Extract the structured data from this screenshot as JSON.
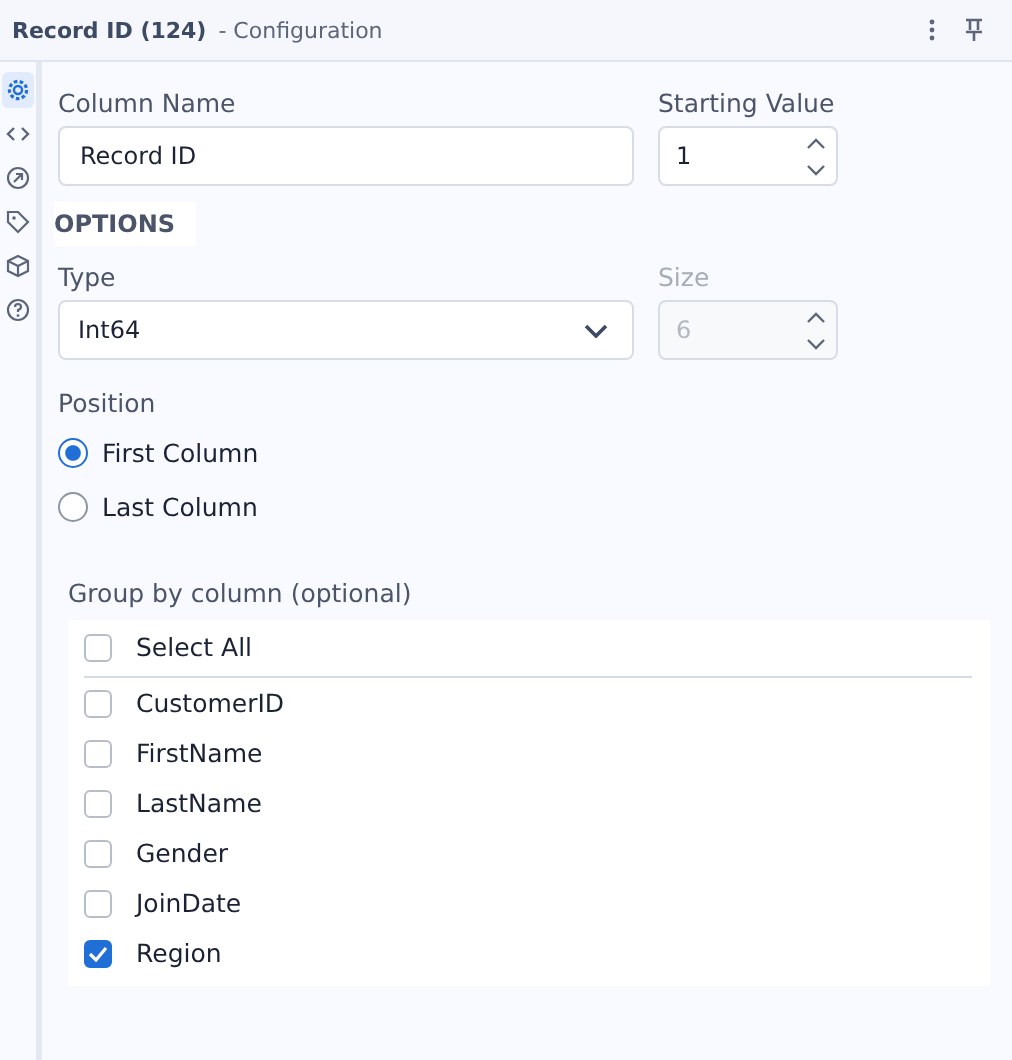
{
  "header": {
    "title": "Record ID (124)",
    "subtitle": "- Configuration"
  },
  "sidebar": {
    "items": [
      {
        "kind": "gear",
        "selected": true
      },
      {
        "kind": "code",
        "selected": false
      },
      {
        "kind": "arrow",
        "selected": false
      },
      {
        "kind": "tag",
        "selected": false
      },
      {
        "kind": "cube",
        "selected": false
      },
      {
        "kind": "help",
        "selected": false
      }
    ]
  },
  "column_name": {
    "label": "Column Name",
    "value": "Record ID"
  },
  "starting_value": {
    "label": "Starting Value",
    "value": "1",
    "disabled": false
  },
  "options_heading": "OPTIONS",
  "type": {
    "label": "Type",
    "value": "Int64"
  },
  "size": {
    "label": "Size",
    "value": "6",
    "disabled": true
  },
  "position": {
    "label": "Position",
    "options": [
      {
        "label": "First Column",
        "selected": true
      },
      {
        "label": "Last Column",
        "selected": false
      }
    ]
  },
  "group_by": {
    "label": "Group by column (optional)",
    "select_all": {
      "label": "Select All",
      "checked": false
    },
    "columns": [
      {
        "label": "CustomerID",
        "checked": false
      },
      {
        "label": "FirstName",
        "checked": false
      },
      {
        "label": "LastName",
        "checked": false
      },
      {
        "label": "Gender",
        "checked": false
      },
      {
        "label": "JoinDate",
        "checked": false
      },
      {
        "label": "Region",
        "checked": true
      }
    ]
  }
}
